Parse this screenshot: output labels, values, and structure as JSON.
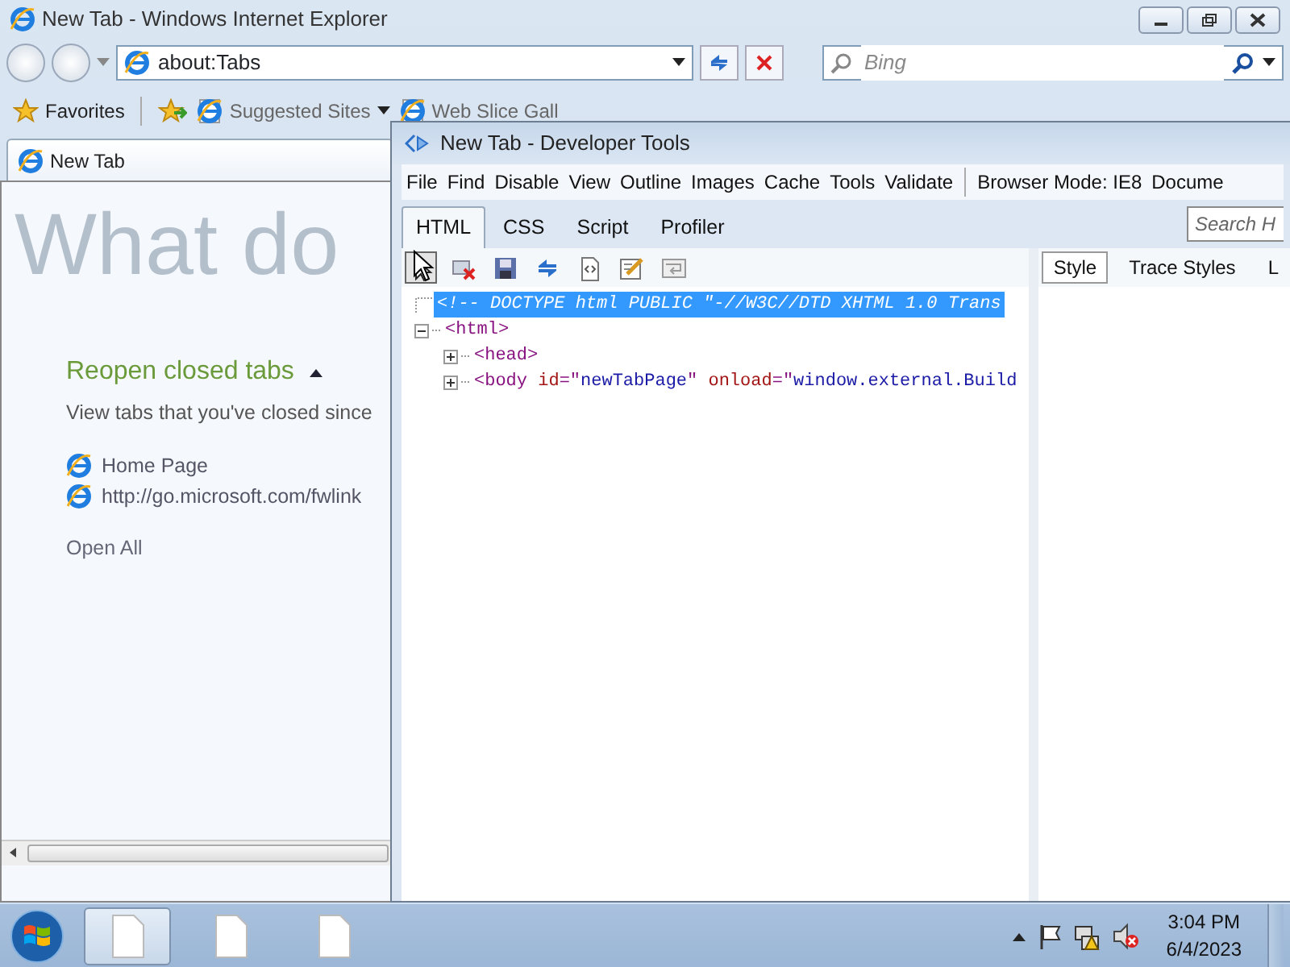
{
  "ie_window": {
    "title": "New Tab - Windows Internet Explorer",
    "address": "about:Tabs",
    "search": {
      "placeholder": "Bing"
    },
    "favorites_bar": {
      "favorites": "Favorites",
      "links": [
        "Suggested Sites",
        "Web Slice Gall"
      ]
    },
    "tabs": [
      {
        "label": "New Tab",
        "selected": true
      }
    ],
    "page": {
      "heading": "What do",
      "section_title": "Reopen closed tabs",
      "expanded": true,
      "description": "View tabs that you've closed since",
      "closed_tabs": [
        "Home Page",
        "http://go.microsoft.com/fwlink"
      ],
      "open_all": "Open All"
    }
  },
  "devtools": {
    "title": "New Tab - Developer Tools",
    "menu": [
      "File",
      "Find",
      "Disable",
      "View",
      "Outline",
      "Images",
      "Cache",
      "Tools",
      "Validate"
    ],
    "browser_mode": "Browser Mode: IE8",
    "document_mode": "Docume",
    "tabs": [
      {
        "label": "HTML",
        "selected": true
      },
      {
        "label": "CSS",
        "selected": false
      },
      {
        "label": "Script",
        "selected": false
      },
      {
        "label": "Profiler",
        "selected": false
      }
    ],
    "search": {
      "placeholder": "Search H"
    },
    "tree": [
      {
        "kind": "comment",
        "selected": true,
        "parts": [
          {
            "kind": "comment",
            "text": "<!-- DOCTYPE html PUBLIC \"-//W3C//DTD XHTML 1.0 Trans"
          }
        ]
      },
      {
        "kind": "element",
        "selected": false,
        "expanded": true,
        "parts": [
          {
            "kind": "tag",
            "text": "<html>"
          }
        ],
        "children": [
          {
            "kind": "element",
            "selected": false,
            "expanded": false,
            "parts": [
              {
                "kind": "tag",
                "text": "<head>"
              }
            ]
          },
          {
            "kind": "element",
            "selected": false,
            "expanded": false,
            "parts": [
              {
                "kind": "tag",
                "text": "<body "
              },
              {
                "kind": "attr",
                "text": "id"
              },
              {
                "kind": "tag",
                "text": "=\""
              },
              {
                "kind": "value",
                "text": "newTabPage"
              },
              {
                "kind": "tag",
                "text": "\" "
              },
              {
                "kind": "attr",
                "text": "onload"
              },
              {
                "kind": "tag",
                "text": "=\""
              },
              {
                "kind": "value",
                "text": "window.external.Build"
              }
            ]
          }
        ]
      }
    ],
    "side_tabs": [
      {
        "label": "Style",
        "selected": true
      },
      {
        "label": "Trace Styles",
        "selected": false
      },
      {
        "label": "L",
        "selected": false
      }
    ]
  },
  "taskbar": {
    "buttons": [
      {
        "selected": true
      },
      {
        "selected": false
      },
      {
        "selected": false
      }
    ],
    "time": "3:04 PM",
    "date": "6/4/2023"
  }
}
